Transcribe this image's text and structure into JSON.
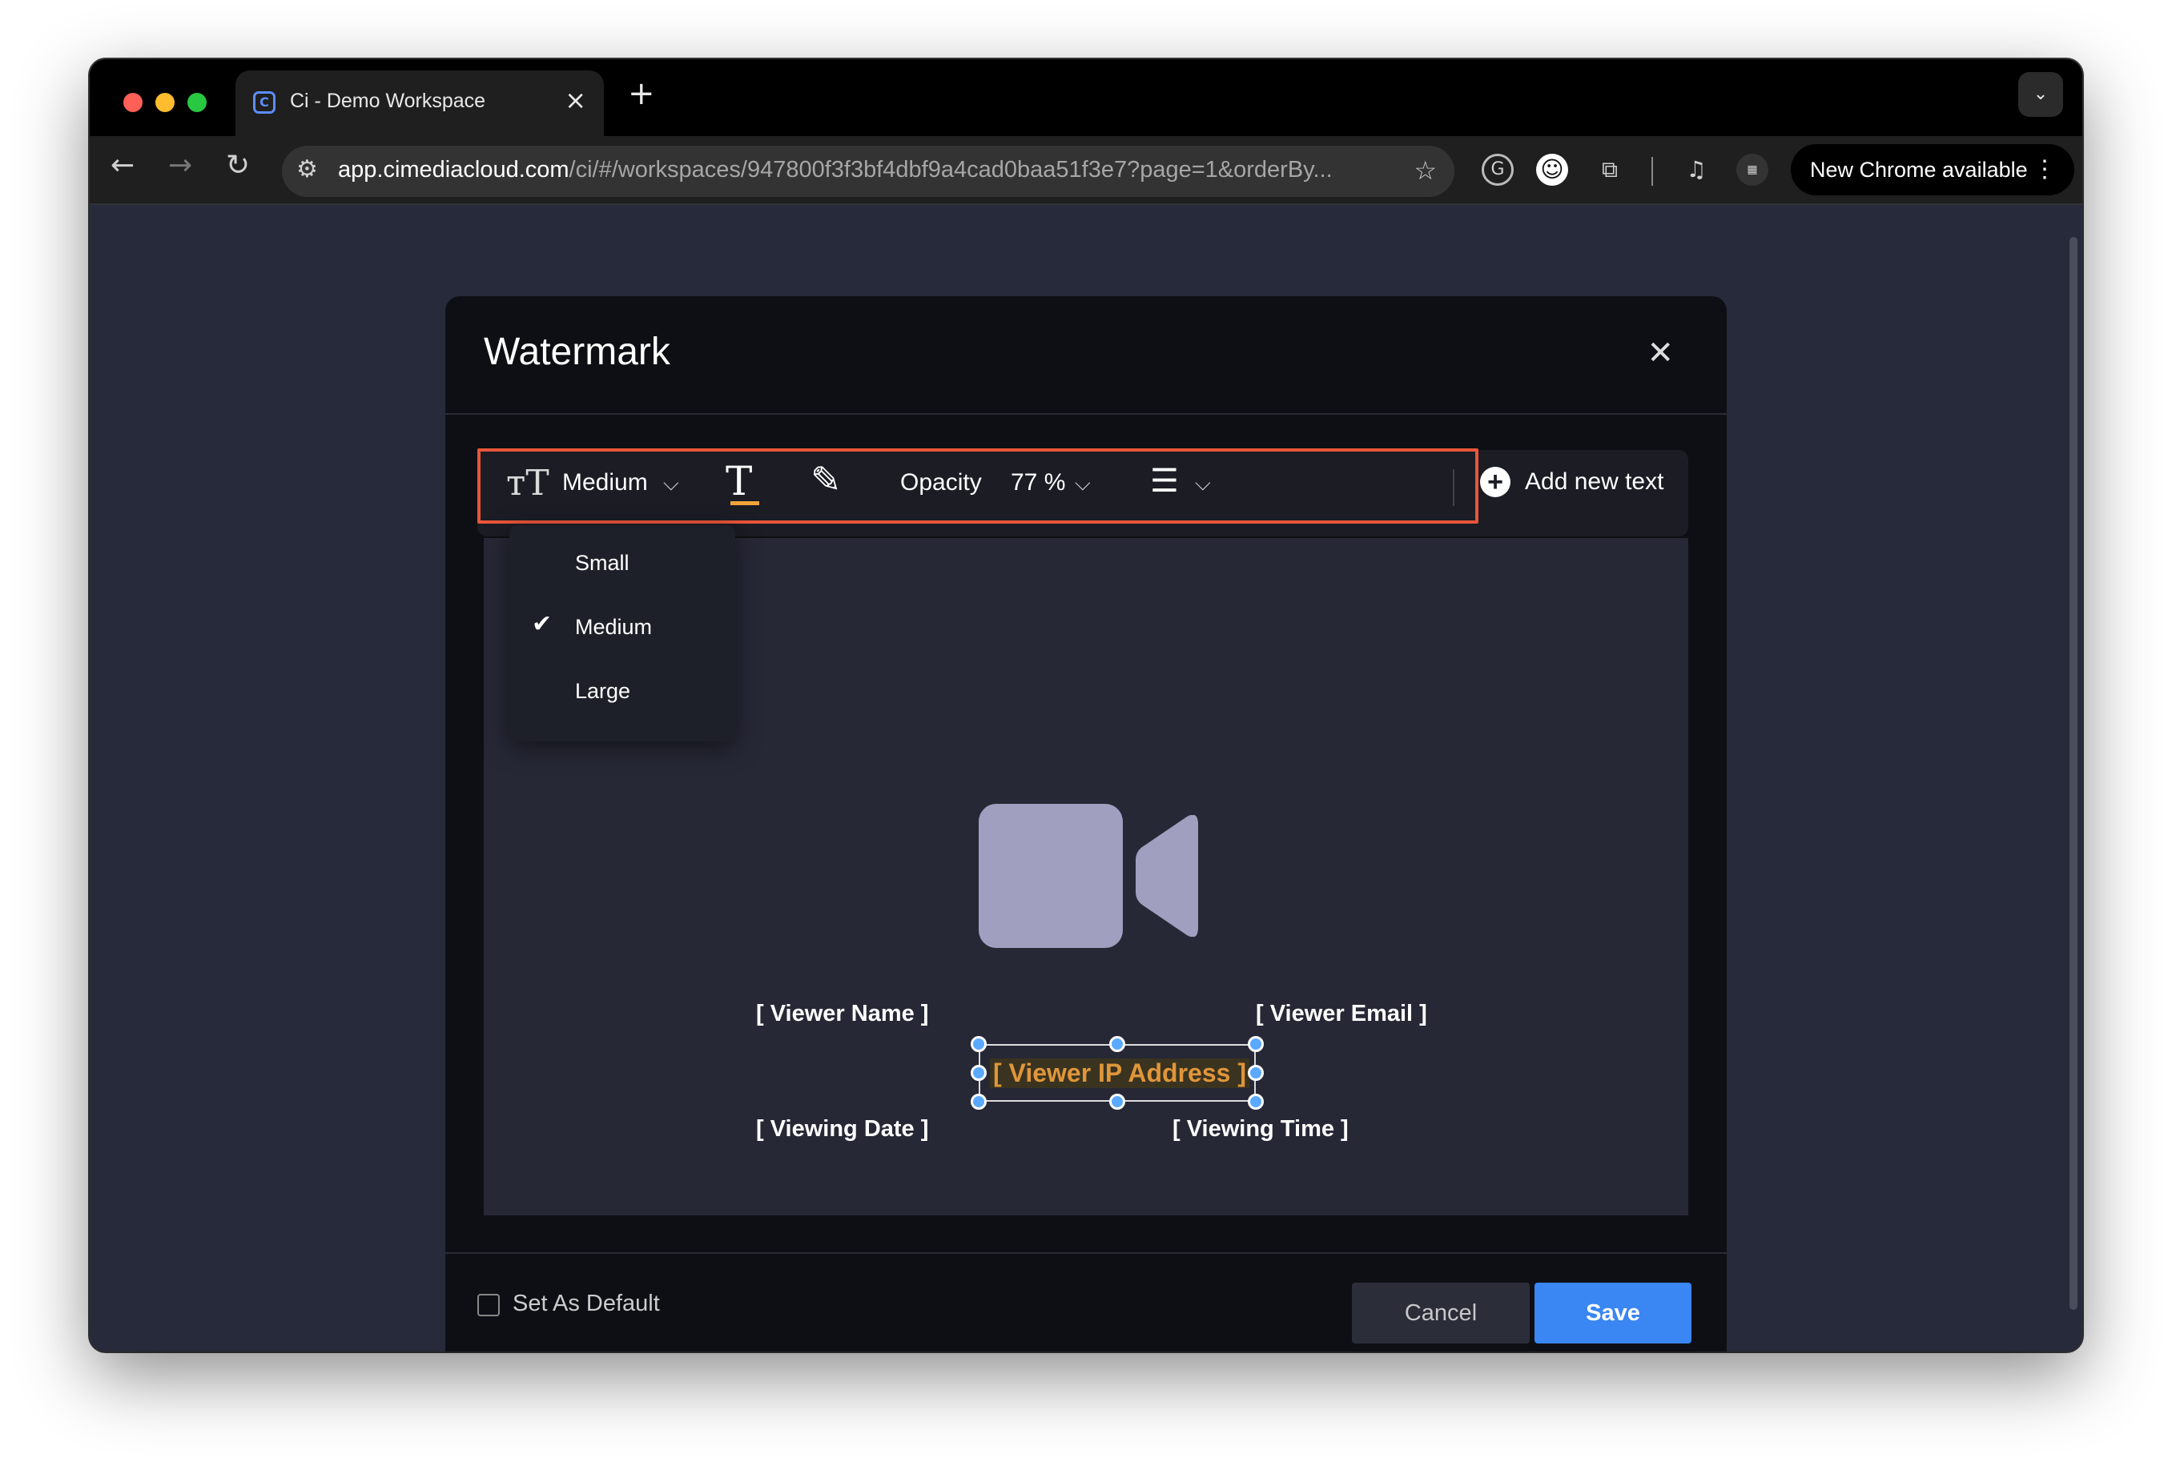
{
  "browser": {
    "tab_title": "Ci - Demo Workspace",
    "tab_favicon_letter": "C",
    "url_host": "app.cimediacloud.com",
    "url_rest": "/ci/#/workspaces/947800f3f3bf4dbf9a4cad0baa51f3e7?page=1&orderBy...",
    "new_chrome_label": "New Chrome available"
  },
  "modal": {
    "title": "Watermark",
    "toolbar": {
      "size_label": "Medium",
      "opacity_label": "Opacity",
      "opacity_value": "77 %",
      "add_text_label": "Add new text"
    },
    "size_menu": {
      "options": [
        "Small",
        "Medium",
        "Large"
      ],
      "selected": "Medium"
    },
    "preview": {
      "viewer_name": "[ Viewer Name ]",
      "viewer_email": "[ Viewer Email ]",
      "viewer_ip": "[ Viewer IP Address ]",
      "viewing_date": "[ Viewing Date ]",
      "viewing_time": "[ Viewing Time ]"
    },
    "footer": {
      "set_default_label": "Set As Default",
      "set_default_checked": false,
      "cancel_label": "Cancel",
      "save_label": "Save"
    }
  },
  "colors": {
    "accent_blue": "#3a86f2",
    "highlight_red": "#e8563a",
    "selected_text_orange": "#e0963a",
    "camera_icon": "#a09fbf"
  }
}
